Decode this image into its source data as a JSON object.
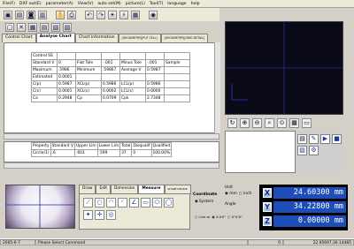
{
  "menu": [
    "File(F)",
    "DXF out(E)",
    "parameter(A)",
    "View(V)",
    "auto set(M)",
    "picture(L)",
    "Tool(T)",
    "language",
    "help"
  ],
  "tabs": [
    {
      "label": "Control Chart",
      "active": false
    },
    {
      "label": "Analyse Chart",
      "active": true
    },
    {
      "label": "Chart Information",
      "active": false
    },
    {
      "label": "[GEOGMETRY][PUT CELL]",
      "active": false
    },
    {
      "label": "[GEOGMETRY][GRID DETAIL]",
      "active": false
    }
  ],
  "table": {
    "rows": [
      [
        "Control SS",
        "",
        "",
        "",
        "",
        "",
        ""
      ],
      [
        "Standard V",
        "0",
        "Flat Tole",
        "-.001",
        "Minus Tole",
        "-.001",
        "Sample"
      ],
      [
        "Maximum",
        ".5986",
        "Minimum",
        ".59867",
        "Average V",
        "0.5987",
        ""
      ],
      [
        "Estimated",
        "0.0001",
        "",
        "",
        "",
        "",
        ""
      ],
      [
        "C(p)",
        "0.5987",
        "XCL(p)",
        "0.5986",
        "LCL(p)",
        "0.5986",
        ""
      ],
      [
        "C(s)",
        "0.0001",
        "XCL(s)",
        "0.0002",
        "LCL(s)",
        "0.0000",
        ""
      ],
      [
        "Ca",
        "0.2948",
        "Cp",
        "0.0709",
        "Cpk",
        "2.7348",
        ""
      ]
    ]
  },
  "lower_table": {
    "headers": [
      "Property",
      "Standard V",
      "Upper Lim",
      "Lower Lim",
      "Total",
      "Disqualif",
      "Qualified"
    ],
    "rows": [
      [
        "Circle(1)",
        ".6",
        ".601",
        ".599",
        "37",
        "0",
        "100.00%"
      ]
    ]
  },
  "command_tabs": [
    "Draw",
    "Edit",
    "Dimension",
    "Measure",
    "SHAPE DEVICE"
  ],
  "coordinate": {
    "group_label": "Coordinate",
    "system_label": "System",
    "unit_label": "Unit",
    "unit_options": [
      "mm",
      "inch"
    ],
    "angle_label": "Angle",
    "angle_options": [
      "Line ar",
      "X.XX°",
      "X°X'X\""
    ]
  },
  "dro": [
    {
      "axis": "X",
      "value": "24.60300 mm"
    },
    {
      "axis": "Y",
      "value": "34.22800 mm"
    },
    {
      "axis": "Z",
      "value": "0.00000 mm"
    }
  ],
  "status": {
    "date": "2005-6-7",
    "message": "Please Select Command",
    "zero": "0",
    "coords": "22.95697,36.14485"
  },
  "colors": {
    "dro_bg": "#1c4db8",
    "viewer_bg": "#0a0a18",
    "crosshair": "#2f3dbf"
  }
}
